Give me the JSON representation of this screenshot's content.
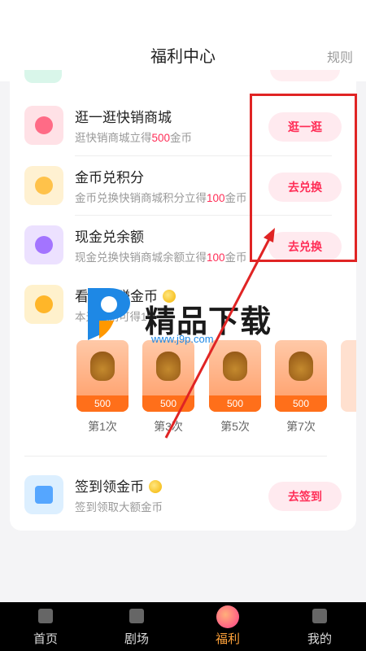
{
  "header": {
    "title": "福利中心",
    "rules_label": "规则"
  },
  "tasks": [
    {
      "title": "逛一逛快销商城",
      "sub_pre": "逛快销商城立得",
      "sub_hl": "500",
      "sub_post": "金币",
      "button": "逛一逛",
      "icon": "mall-bag-icon",
      "icon_color": "#ff6b86"
    },
    {
      "title": "金币兑积分",
      "sub_pre": "金币兑换快销商城积分立得",
      "sub_hl": "100",
      "sub_post": "金币",
      "button": "去兑换",
      "icon": "coin-exchange-icon",
      "icon_color": "#ffc24a"
    },
    {
      "title": "现金兑余额",
      "sub_pre": "现金兑换快销商城余额立得",
      "sub_hl": "100",
      "sub_post": "金币",
      "button": "去兑换",
      "icon": "cash-balance-icon",
      "icon_color": "#a374ff"
    },
    {
      "title": "看短剧赚金币",
      "sub_pre": "本天看剧可得1",
      "sub_hl": "",
      "sub_post": "",
      "button": "",
      "icon": "watch-drama-coin-icon",
      "icon_color": "#ffb629"
    },
    {
      "title": "签到领金币",
      "sub_pre": "签到领取大额金币",
      "sub_hl": "",
      "sub_post": "",
      "button": "去签到",
      "icon": "calendar-icon",
      "icon_color": "#55a6ff"
    }
  ],
  "rewards": [
    {
      "amount": "500",
      "label": "第1次"
    },
    {
      "amount": "500",
      "label": "第3次"
    },
    {
      "amount": "500",
      "label": "第5次"
    },
    {
      "amount": "500",
      "label": "第7次"
    }
  ],
  "watermark": {
    "text": "精品下载",
    "url": "www.j9p.com"
  },
  "tabbar": [
    {
      "label": "首页",
      "icon": "home-icon"
    },
    {
      "label": "剧场",
      "icon": "theater-icon"
    },
    {
      "label": "福利",
      "icon": "welfare-icon",
      "active": true
    },
    {
      "label": "我的",
      "icon": "profile-icon"
    }
  ],
  "colors": {
    "accent": "#ff2e57",
    "tab_active": "#ffa23a",
    "annotation": "#e02424"
  }
}
